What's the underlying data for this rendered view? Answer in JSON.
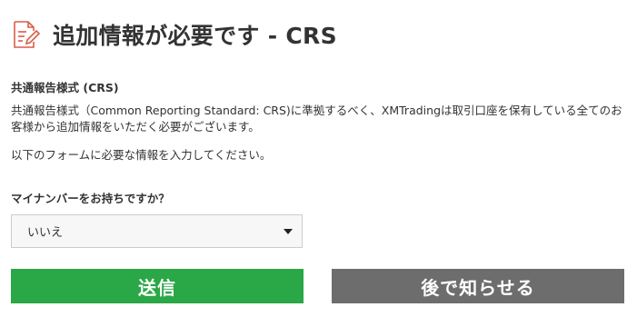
{
  "header": {
    "icon": "document-edit-icon",
    "icon_color": "#d95c4a",
    "title": "追加情報が必要です - CRS"
  },
  "section": {
    "title": "共通報告様式 (CRS)",
    "paragraph_1": "共通報告様式（Common Reporting Standard: CRS)に準拠するべく、XMTradingは取引口座を保有している全てのお客様から追加情報をいただく必要がございます。",
    "paragraph_2": "以下のフォームに必要な情報を入力してください。"
  },
  "form": {
    "question": "マイナンバーをお持ちですか？",
    "select_value": "いいえ",
    "select_icon": "caret-down-icon"
  },
  "buttons": {
    "submit_label": "送信",
    "submit_color": "#2aa746",
    "later_label": "後で知らせる",
    "later_color": "#6d6d6d"
  }
}
